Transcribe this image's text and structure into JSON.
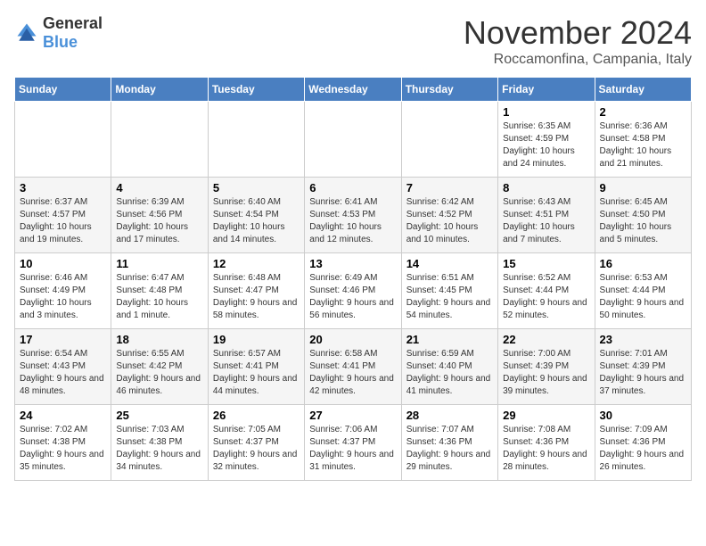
{
  "header": {
    "logo_general": "General",
    "logo_blue": "Blue",
    "month_title": "November 2024",
    "location": "Roccamonfina, Campania, Italy"
  },
  "weekdays": [
    "Sunday",
    "Monday",
    "Tuesday",
    "Wednesday",
    "Thursday",
    "Friday",
    "Saturday"
  ],
  "weeks": [
    [
      {
        "day": "",
        "info": ""
      },
      {
        "day": "",
        "info": ""
      },
      {
        "day": "",
        "info": ""
      },
      {
        "day": "",
        "info": ""
      },
      {
        "day": "",
        "info": ""
      },
      {
        "day": "1",
        "info": "Sunrise: 6:35 AM\nSunset: 4:59 PM\nDaylight: 10 hours and 24 minutes."
      },
      {
        "day": "2",
        "info": "Sunrise: 6:36 AM\nSunset: 4:58 PM\nDaylight: 10 hours and 21 minutes."
      }
    ],
    [
      {
        "day": "3",
        "info": "Sunrise: 6:37 AM\nSunset: 4:57 PM\nDaylight: 10 hours and 19 minutes."
      },
      {
        "day": "4",
        "info": "Sunrise: 6:39 AM\nSunset: 4:56 PM\nDaylight: 10 hours and 17 minutes."
      },
      {
        "day": "5",
        "info": "Sunrise: 6:40 AM\nSunset: 4:54 PM\nDaylight: 10 hours and 14 minutes."
      },
      {
        "day": "6",
        "info": "Sunrise: 6:41 AM\nSunset: 4:53 PM\nDaylight: 10 hours and 12 minutes."
      },
      {
        "day": "7",
        "info": "Sunrise: 6:42 AM\nSunset: 4:52 PM\nDaylight: 10 hours and 10 minutes."
      },
      {
        "day": "8",
        "info": "Sunrise: 6:43 AM\nSunset: 4:51 PM\nDaylight: 10 hours and 7 minutes."
      },
      {
        "day": "9",
        "info": "Sunrise: 6:45 AM\nSunset: 4:50 PM\nDaylight: 10 hours and 5 minutes."
      }
    ],
    [
      {
        "day": "10",
        "info": "Sunrise: 6:46 AM\nSunset: 4:49 PM\nDaylight: 10 hours and 3 minutes."
      },
      {
        "day": "11",
        "info": "Sunrise: 6:47 AM\nSunset: 4:48 PM\nDaylight: 10 hours and 1 minute."
      },
      {
        "day": "12",
        "info": "Sunrise: 6:48 AM\nSunset: 4:47 PM\nDaylight: 9 hours and 58 minutes."
      },
      {
        "day": "13",
        "info": "Sunrise: 6:49 AM\nSunset: 4:46 PM\nDaylight: 9 hours and 56 minutes."
      },
      {
        "day": "14",
        "info": "Sunrise: 6:51 AM\nSunset: 4:45 PM\nDaylight: 9 hours and 54 minutes."
      },
      {
        "day": "15",
        "info": "Sunrise: 6:52 AM\nSunset: 4:44 PM\nDaylight: 9 hours and 52 minutes."
      },
      {
        "day": "16",
        "info": "Sunrise: 6:53 AM\nSunset: 4:44 PM\nDaylight: 9 hours and 50 minutes."
      }
    ],
    [
      {
        "day": "17",
        "info": "Sunrise: 6:54 AM\nSunset: 4:43 PM\nDaylight: 9 hours and 48 minutes."
      },
      {
        "day": "18",
        "info": "Sunrise: 6:55 AM\nSunset: 4:42 PM\nDaylight: 9 hours and 46 minutes."
      },
      {
        "day": "19",
        "info": "Sunrise: 6:57 AM\nSunset: 4:41 PM\nDaylight: 9 hours and 44 minutes."
      },
      {
        "day": "20",
        "info": "Sunrise: 6:58 AM\nSunset: 4:41 PM\nDaylight: 9 hours and 42 minutes."
      },
      {
        "day": "21",
        "info": "Sunrise: 6:59 AM\nSunset: 4:40 PM\nDaylight: 9 hours and 41 minutes."
      },
      {
        "day": "22",
        "info": "Sunrise: 7:00 AM\nSunset: 4:39 PM\nDaylight: 9 hours and 39 minutes."
      },
      {
        "day": "23",
        "info": "Sunrise: 7:01 AM\nSunset: 4:39 PM\nDaylight: 9 hours and 37 minutes."
      }
    ],
    [
      {
        "day": "24",
        "info": "Sunrise: 7:02 AM\nSunset: 4:38 PM\nDaylight: 9 hours and 35 minutes."
      },
      {
        "day": "25",
        "info": "Sunrise: 7:03 AM\nSunset: 4:38 PM\nDaylight: 9 hours and 34 minutes."
      },
      {
        "day": "26",
        "info": "Sunrise: 7:05 AM\nSunset: 4:37 PM\nDaylight: 9 hours and 32 minutes."
      },
      {
        "day": "27",
        "info": "Sunrise: 7:06 AM\nSunset: 4:37 PM\nDaylight: 9 hours and 31 minutes."
      },
      {
        "day": "28",
        "info": "Sunrise: 7:07 AM\nSunset: 4:36 PM\nDaylight: 9 hours and 29 minutes."
      },
      {
        "day": "29",
        "info": "Sunrise: 7:08 AM\nSunset: 4:36 PM\nDaylight: 9 hours and 28 minutes."
      },
      {
        "day": "30",
        "info": "Sunrise: 7:09 AM\nSunset: 4:36 PM\nDaylight: 9 hours and 26 minutes."
      }
    ]
  ]
}
